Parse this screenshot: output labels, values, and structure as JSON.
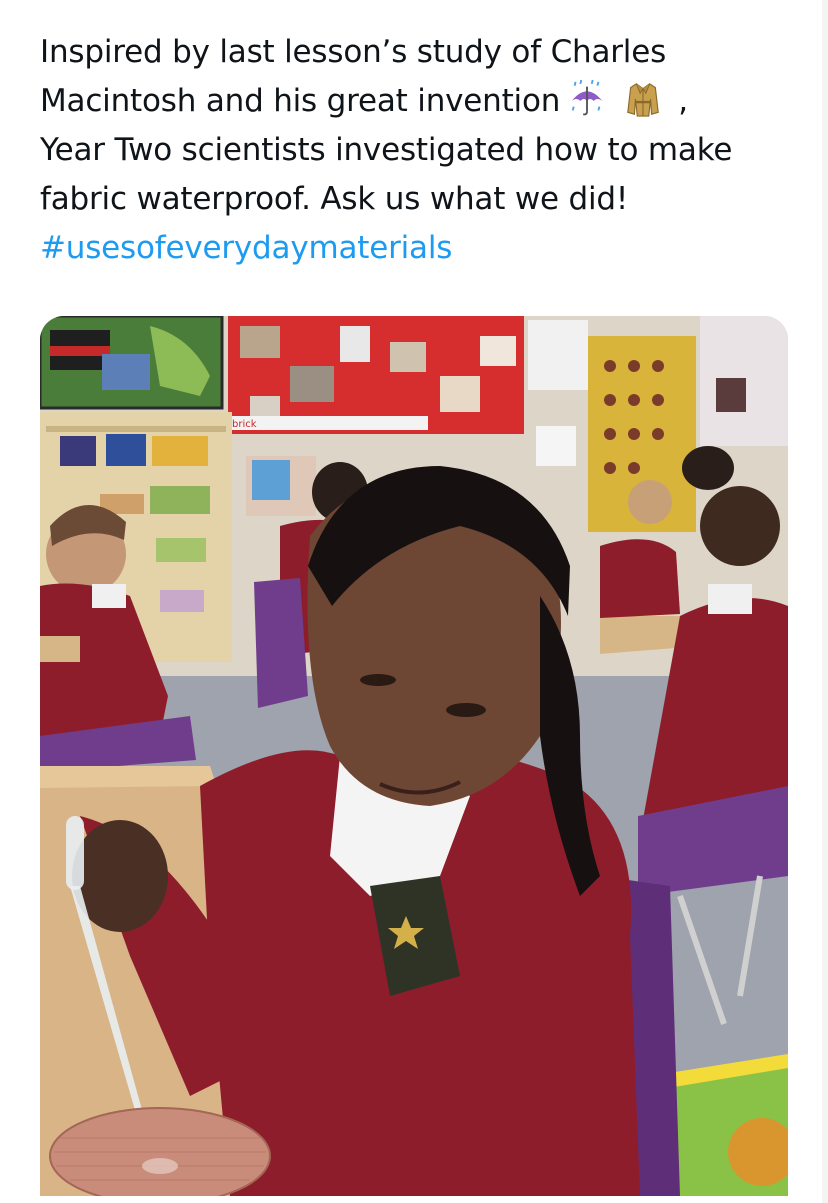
{
  "tweet": {
    "text_line1": "Inspired by last lesson’s study of Charles",
    "text_line2": "Macintosh and his great invention",
    "text_line2_end": ",",
    "text_line3": "Year Two scientists investigated how to make",
    "text_line4": "fabric waterproof. Ask us what we did!",
    "hashtag": "#usesofeverydaymaterials",
    "emojis": [
      "umbrella-with-rain-icon",
      "coat-icon"
    ]
  },
  "colors": {
    "text": "#0f1419",
    "hashtag": "#1d9bf0",
    "uniform": "#8e1d2c",
    "chair": "#6f3d8c"
  },
  "photo": {
    "display_label": "brick"
  }
}
